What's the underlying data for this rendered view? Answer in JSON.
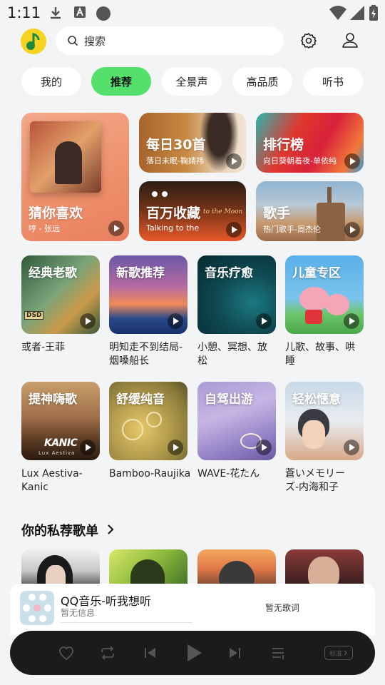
{
  "status_bar": {
    "time": "1:11"
  },
  "header": {
    "search_placeholder": "搜索"
  },
  "tabs": [
    {
      "label": "我的",
      "active": false
    },
    {
      "label": "推荐",
      "active": true
    },
    {
      "label": "全景声",
      "active": false
    },
    {
      "label": "高品质",
      "active": false
    },
    {
      "label": "听书",
      "active": false
    }
  ],
  "feature_cards": {
    "guess": {
      "title": "猜你喜欢",
      "subtitle": "哼 - 张远"
    },
    "daily": {
      "title": "每日30首",
      "subtitle": "落日未眠-鞠婧祎"
    },
    "ranking": {
      "title": "排行榜",
      "subtitle": "向日葵朝着夜-单依纯"
    },
    "million": {
      "title": "百万收藏",
      "subtitle": "Talking to the",
      "art_text": "to the Moon"
    },
    "singer": {
      "title": "歌手",
      "subtitle": "热门歌手-周杰伦"
    }
  },
  "grid": [
    {
      "title": "经典老歌",
      "caption": "或者-王菲",
      "badge": "DSD"
    },
    {
      "title": "新歌推荐",
      "caption": "明知走不到结局-烟嗓船长"
    },
    {
      "title": "音乐疗愈",
      "caption": "小憩、冥想、放松"
    },
    {
      "title": "儿童专区",
      "caption": "儿歌、故事、哄睡"
    },
    {
      "title": "提神嗨歌",
      "caption": "Lux Aestiva-Kanic",
      "art_text": "KANIC",
      "art_sub": "Lux Aestiva"
    },
    {
      "title": "舒缓纯音",
      "caption": "Bamboo-Raujika"
    },
    {
      "title": "自驾出游",
      "caption": "WAVE-花たん"
    },
    {
      "title": "轻松惬意",
      "caption": "蒼いメモリーズ-内海和子"
    }
  ],
  "section": {
    "title": "你的私荐歌单"
  },
  "player": {
    "title": "QQ音乐-听我想听",
    "subtitle": "暂无信息",
    "lyric": "暂无歌词",
    "quality": "标准"
  },
  "colors": {
    "accent": "#55e06c",
    "background": "#f3f4f6",
    "control_bar": "#1b1b1b"
  }
}
